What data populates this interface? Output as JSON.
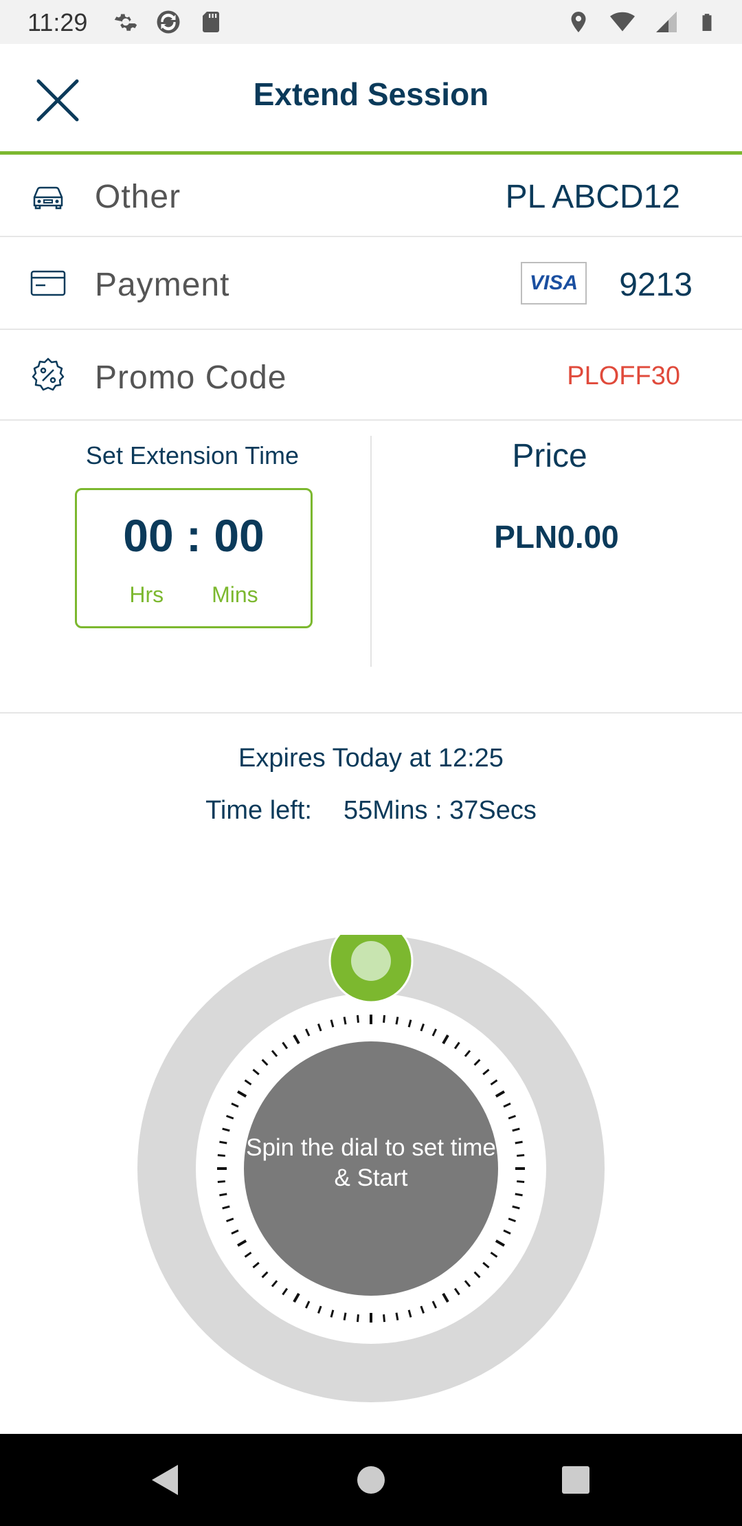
{
  "status_bar": {
    "time": "11:29",
    "left_icons": [
      "settings-icon",
      "sync-icon",
      "sd-card-icon"
    ],
    "right_icons": [
      "location-icon",
      "wifi-icon",
      "signal-icon",
      "battery-icon"
    ]
  },
  "header": {
    "title": "Extend Session",
    "close_icon": "close-icon",
    "accent_color": "#7cb82f"
  },
  "vehicle_row": {
    "icon": "car-icon",
    "label": "Other",
    "value": "PL ABCD12"
  },
  "payment_row": {
    "icon": "credit-card-icon",
    "label": "Payment",
    "card_brand": "VISA",
    "card_last4": "9213"
  },
  "promo_row": {
    "icon": "promo-badge-icon",
    "label": "Promo Code",
    "value": "PLOFF30",
    "value_color": "#e04a3b"
  },
  "extension": {
    "label": "Set Extension Time",
    "time_display": "00 : 00",
    "hours_label": "Hrs",
    "minutes_label": "Mins"
  },
  "price": {
    "label": "Price",
    "value": "PLN0.00"
  },
  "session": {
    "expires_text": "Expires Today at 12:25",
    "time_left_label": "Time left:",
    "time_left_value": "55Mins : 37Secs"
  },
  "dial": {
    "center_text": "Spin the dial to set time & Start",
    "handle_color": "#7cb82f"
  },
  "nav_bar": {
    "buttons": [
      "back-icon",
      "home-icon",
      "recents-icon"
    ]
  }
}
